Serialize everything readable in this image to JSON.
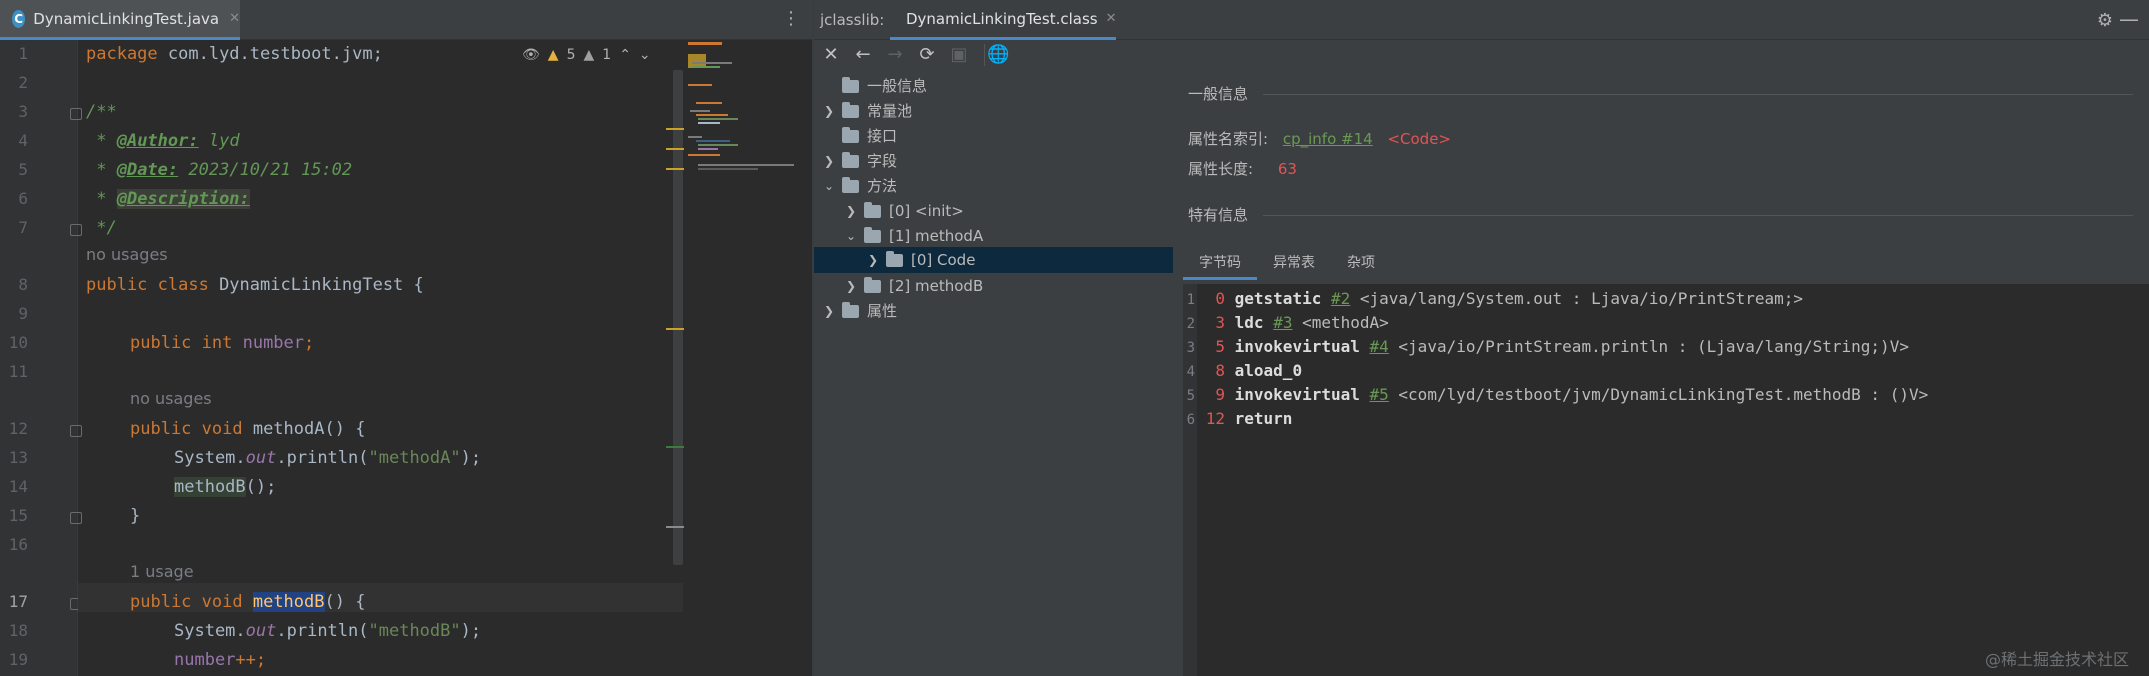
{
  "editor": {
    "tab": {
      "icon": "java-class-icon",
      "letter": "C",
      "label": "DynamicLinkingTest.java"
    },
    "inspection": {
      "warnings": "5",
      "weak_warnings": "1"
    },
    "line_numbers": [
      "1",
      "2",
      "3",
      "4",
      "5",
      "6",
      "7",
      "8",
      "9",
      "10",
      "11",
      "12",
      "13",
      "14",
      "15",
      "16",
      "17",
      "18",
      "19"
    ],
    "hints": {
      "no_usages_1": "no usages",
      "no_usages_2": "no usages",
      "one_usage": "1 usage"
    },
    "code": {
      "l1_kw": "package",
      "l1_rest": " com.lyd.testboot.jvm;",
      "l3": "/**",
      "l4_star": " * ",
      "l4_tag": "@Author:",
      "l4_val": " lyd",
      "l5_star": " * ",
      "l5_tag": "@Date:",
      "l5_val": " 2023/10/21 15:02",
      "l6_star": " * ",
      "l6_tag": "@Description:",
      "l7": " */",
      "l8_kw": "public class",
      "l8_rest": " DynamicLinkingTest {",
      "l10_kw": "public int",
      "l10_fld": " number",
      "l10_end": ";",
      "l12_kw": "public void",
      "l12_name": " methodA",
      "l12_end": "() {",
      "l13_a": "System.",
      "l13_out": "out",
      "l13_b": ".println(",
      "l13_str": "\"methodA\"",
      "l13_c": ");",
      "l14_call": "methodB",
      "l14_end": "();",
      "l15": "}",
      "l17_kw": "public void",
      "l17_sp": " ",
      "l17_name": "methodB",
      "l17_end": "() {",
      "l18_a": "System.",
      "l18_out": "out",
      "l18_b": ".println(",
      "l18_str": "\"methodB\"",
      "l18_c": ");",
      "l19_fld": "number",
      "l19_end": "++;"
    }
  },
  "jclasslib": {
    "title": "jclasslib:",
    "tab_label": "DynamicLinkingTest.class",
    "tree": [
      {
        "label": "一般信息"
      },
      {
        "label": "常量池"
      },
      {
        "label": "接口"
      },
      {
        "label": "字段"
      },
      {
        "label": "方法"
      },
      {
        "label": "[0] <init>"
      },
      {
        "label": "[1] methodA"
      },
      {
        "label": "[0] Code"
      },
      {
        "label": "[2] methodB"
      },
      {
        "label": "属性"
      }
    ],
    "general": {
      "title": "一般信息",
      "name_index_label": "属性名索引:",
      "name_index_link": "cp_info #14",
      "name_index_value": "<Code>",
      "length_label": "属性长度:",
      "length_value": "63"
    },
    "specific": {
      "title": "特有信息"
    },
    "tabs": [
      "字节码",
      "异常表",
      "杂项"
    ],
    "bytecode": [
      {
        "line": "1",
        "offset": "0",
        "instr": "getstatic",
        "ref": "#2",
        "comment": " <java/lang/System.out : Ljava/io/PrintStream;>"
      },
      {
        "line": "2",
        "offset": "3",
        "instr": "ldc",
        "ref": "#3",
        "comment": " <methodA>"
      },
      {
        "line": "3",
        "offset": "5",
        "instr": "invokevirtual",
        "ref": "#4",
        "comment": " <java/io/PrintStream.println : (Ljava/lang/String;)V>"
      },
      {
        "line": "4",
        "offset": "8",
        "instr": "aload_0",
        "ref": "",
        "comment": ""
      },
      {
        "line": "5",
        "offset": "9",
        "instr": "invokevirtual",
        "ref": "#5",
        "comment": " <com/lyd/testboot/jvm/DynamicLinkingTest.methodB : ()V>"
      },
      {
        "line": "6",
        "offset": "12",
        "instr": "return",
        "ref": "",
        "comment": ""
      }
    ]
  },
  "watermark": "@稀土掘金技术社区",
  "colors": {
    "accent": "#4a88c7",
    "keyword": "#cc7832",
    "string": "#6a8759",
    "doc": "#629755",
    "field": "#9876aa",
    "error": "#e05555"
  }
}
